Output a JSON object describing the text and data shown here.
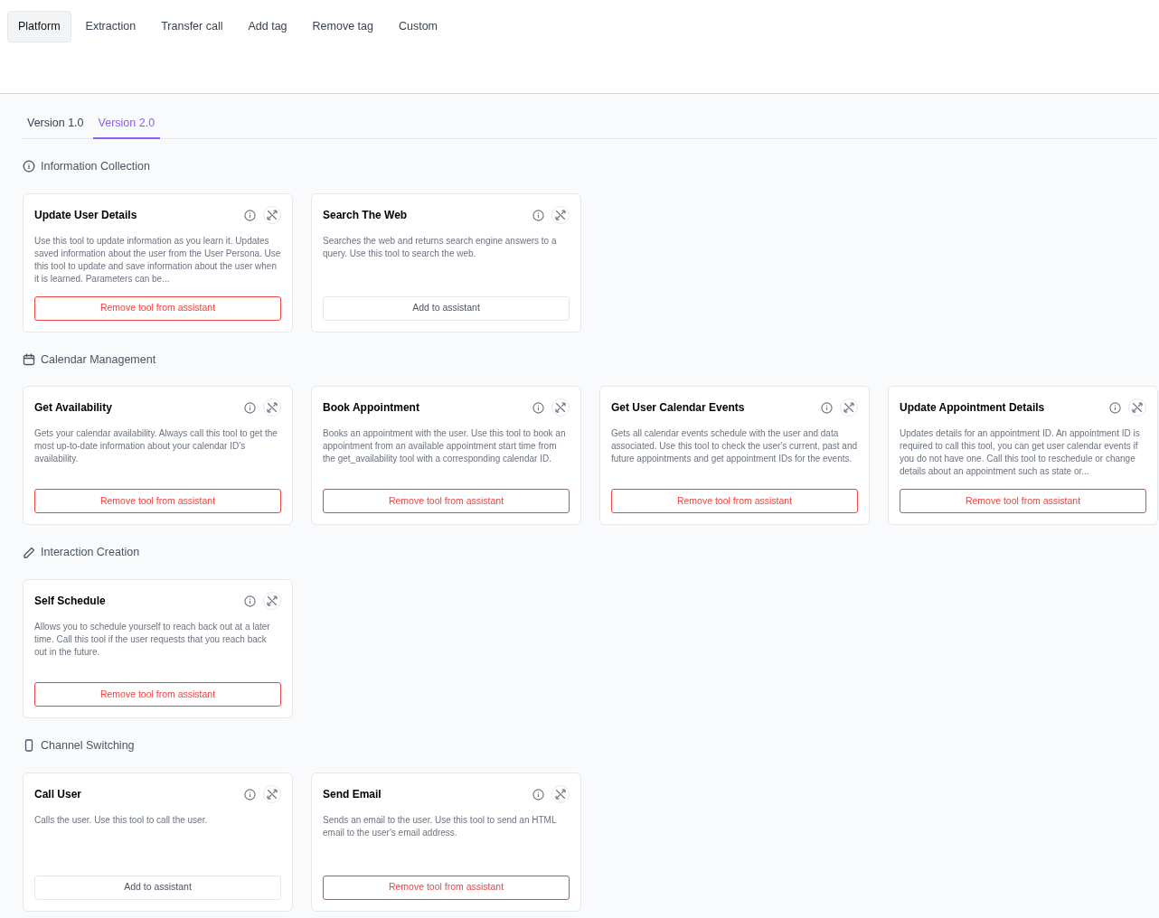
{
  "top_tabs": [
    {
      "label": "Platform",
      "selected": true
    },
    {
      "label": "Extraction",
      "selected": false
    },
    {
      "label": "Transfer call",
      "selected": false
    },
    {
      "label": "Add tag",
      "selected": false
    },
    {
      "label": "Remove tag",
      "selected": false
    },
    {
      "label": "Custom",
      "selected": false
    }
  ],
  "version_tabs": [
    {
      "label": "Version 1.0",
      "selected": false
    },
    {
      "label": "Version 2.0",
      "selected": true
    }
  ],
  "sections": [
    {
      "title": "Information Collection",
      "kind": "info",
      "tools": [
        {
          "name": "Update User Details",
          "description": "Use this tool to update information as you learn it. Updates saved information about the user from the User Persona. Use this tool to update and save information about the user when it is learned. Parameters can be...",
          "added": true,
          "button": "Remove tool from assistant"
        },
        {
          "name": "Search The Web",
          "description": "Searches the web and returns search engine answers to a query. Use this tool to search the web.",
          "added": false,
          "button": "Add to assistant"
        }
      ]
    },
    {
      "title": "Calendar Management",
      "kind": "calendar",
      "tools": [
        {
          "name": "Get Availability",
          "description": "Gets your calendar availability. Always call this tool to get the most up-to-date information about your calendar ID's availability.",
          "added": true,
          "button": "Remove tool from assistant"
        },
        {
          "name": "Book Appointment",
          "description": "Books an appointment with the user. Use this tool to book an appointment from an available appointment start time from the get_availability tool with a corresponding calendar ID.",
          "added": true,
          "button": "Remove tool from assistant"
        },
        {
          "name": "Get User Calendar Events",
          "description": "Gets all calendar events schedule with the user and data associated. Use this tool to check the user's current, past and future appointments and get appointment IDs for the events.",
          "added": true,
          "button": "Remove tool from assistant"
        },
        {
          "name": "Update Appointment Details",
          "description": "Updates details for an appointment ID. An appointment ID is required to call this tool, you can get user calendar events if you do not have one. Call this tool to reschedule or change details about an appointment such as state or...",
          "added": true,
          "button": "Remove tool from assistant"
        }
      ]
    },
    {
      "title": "Interaction Creation",
      "kind": "pencil",
      "tools": [
        {
          "name": "Self Schedule",
          "description": "Allows you to schedule yourself to reach back out at a later time. Call this tool if the user requests that you reach back out in the future.",
          "added": true,
          "button": "Remove tool from assistant"
        }
      ]
    },
    {
      "title": "Channel Switching",
      "kind": "phone",
      "tools": [
        {
          "name": "Call User",
          "description": "Calls the user. Use this tool to call the user.",
          "added": false,
          "button": "Add to assistant"
        },
        {
          "name": "Send Email",
          "description": "Sends an email to the user. Use this tool to send an HTML email to the user's email address.",
          "added": true,
          "button": "Remove tool from assistant"
        }
      ]
    }
  ]
}
